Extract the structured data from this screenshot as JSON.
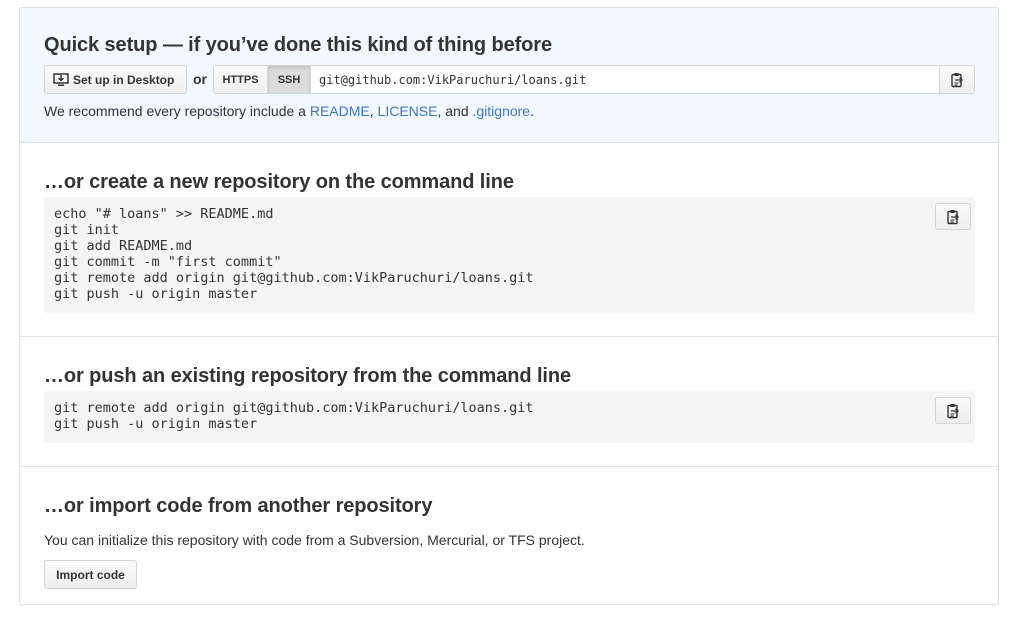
{
  "quick_setup": {
    "title": "Quick setup — if you’ve done this kind of thing before",
    "desktop_button": "Set up in Desktop",
    "or_label": "or",
    "protocols": [
      "HTTPS",
      "SSH"
    ],
    "selected_protocol": "SSH",
    "clone_url": "git@github.com:VikParuchuri/loans.git",
    "recommend_text": {
      "prefix": "We recommend every repository include a ",
      "readme": "README",
      "sep1": ", ",
      "license": "LICENSE",
      "sep2": ", and ",
      "gitignore": ".gitignore",
      "suffix": "."
    }
  },
  "new_repo": {
    "title": "…or create a new repository on the command line",
    "code": "echo \"# loans\" >> README.md\ngit init\ngit add README.md\ngit commit -m \"first commit\"\ngit remote add origin git@github.com:VikParuchuri/loans.git\ngit push -u origin master"
  },
  "push_repo": {
    "title": "…or push an existing repository from the command line",
    "code": "git remote add origin git@github.com:VikParuchuri/loans.git\ngit push -u origin master"
  },
  "import_repo": {
    "title": "…or import code from another repository",
    "description": "You can initialize this repository with code from a Subversion, Mercurial, or TFS project.",
    "button": "Import code"
  },
  "icons": {
    "desktop": "desktop-download-icon",
    "copy": "clippy-icon"
  }
}
